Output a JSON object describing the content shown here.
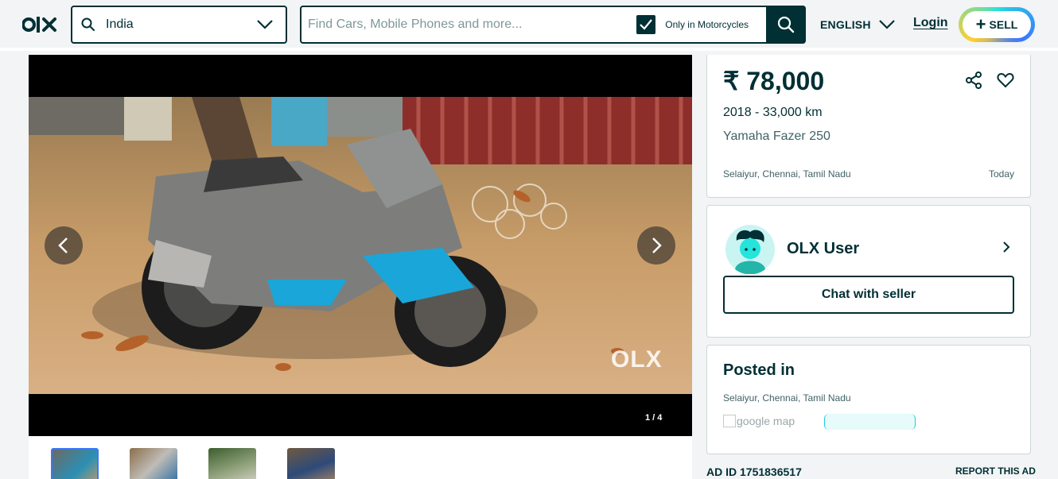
{
  "header": {
    "logo_text": "OLX",
    "location_value": "India",
    "search_placeholder": "Find Cars, Mobile Phones and more...",
    "category_filter_label": "Only in Motorcycles",
    "category_filter_checked": true,
    "language_label": "ENGLISH",
    "login_label": "Login",
    "sell_label": "SELL"
  },
  "gallery": {
    "counter": "1 / 4",
    "watermark": "OLX",
    "thumbnail_count": 4
  },
  "listing": {
    "price": "₹ 78,000",
    "year_km": "2018 - 33,000 km",
    "title": "Yamaha Fazer 250",
    "location": "Selaiyur, Chennai, Tamil Nadu",
    "date": "Today"
  },
  "seller": {
    "name": "OLX User",
    "chat_label": "Chat with seller"
  },
  "posted": {
    "title": "Posted in",
    "location": "Selaiyur, Chennai, Tamil Nadu",
    "map_alt": "google map"
  },
  "footer": {
    "ad_id": "AD ID 1751836517",
    "report_label": "REPORT THIS AD"
  },
  "colors": {
    "brand_dark": "#002f34",
    "sell_ring": [
      "#23e5db",
      "#3a77ff",
      "#ffce32"
    ],
    "background": "#f2f4f5"
  }
}
